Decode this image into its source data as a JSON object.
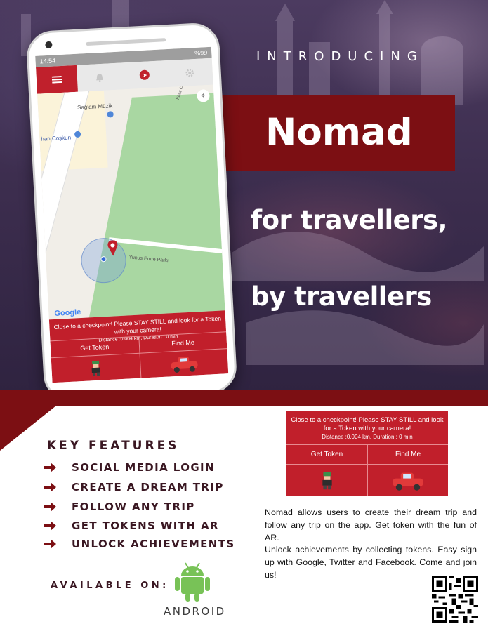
{
  "hero": {
    "kicker": "INTRODUCING",
    "title": "Nomad",
    "tagline_1": "for travellers,",
    "tagline_2": "by travellers"
  },
  "phone": {
    "status": {
      "time": "14:54",
      "right": "%99"
    },
    "map": {
      "labels": [
        "Sağlam Müzik",
        "han Coşkun",
        "Yunus Emre Parkı",
        "Kiraz Cd."
      ],
      "google": "Google"
    },
    "panel": {
      "message": "Close to a checkpoint! Please STAY STILL and look for a Token with your camera!",
      "distance": "Distance :0.004 km, Duration : 0 min",
      "get_token": "Get Token",
      "find_me": "Find Me"
    }
  },
  "panel2": {
    "message": "Close to a checkpoint! Please STAY STILL and look for a Token with your camera!",
    "distance": "Distance :0.004 km, Duration : 0 min",
    "get_token": "Get Token",
    "find_me": "Find Me"
  },
  "features": {
    "title": "KEY FEATURES",
    "items": [
      "SOCIAL MEDIA LOGIN",
      "CREATE A DREAM TRIP",
      "FOLLOW ANY TRIP",
      "GET TOKENS WITH AR",
      "UNLOCK ACHIEVEMENTS"
    ]
  },
  "availability": {
    "label": "AVAILABLE ON:",
    "platform": "ANDROID"
  },
  "description": {
    "p1": "Nomad allows users to create their dream trip and follow any trip on the app. Get token with the fun of AR.",
    "p2": "Unlock achievements by collecting tokens. Easy sign up with Google, Twitter and Facebook. Come and join us!"
  },
  "colors": {
    "brand_dark_red": "#7c0f13",
    "app_red": "#c11f2b",
    "text_dark": "#3a1722",
    "android_green": "#78c257"
  },
  "icons": [
    "hamburger-menu-icon",
    "bell-icon",
    "navigation-icon",
    "gear-icon",
    "map-pin-icon",
    "arrow-right-icon",
    "android-robot-icon",
    "qr-code-icon",
    "trainer-sprite-icon",
    "red-car-icon"
  ]
}
